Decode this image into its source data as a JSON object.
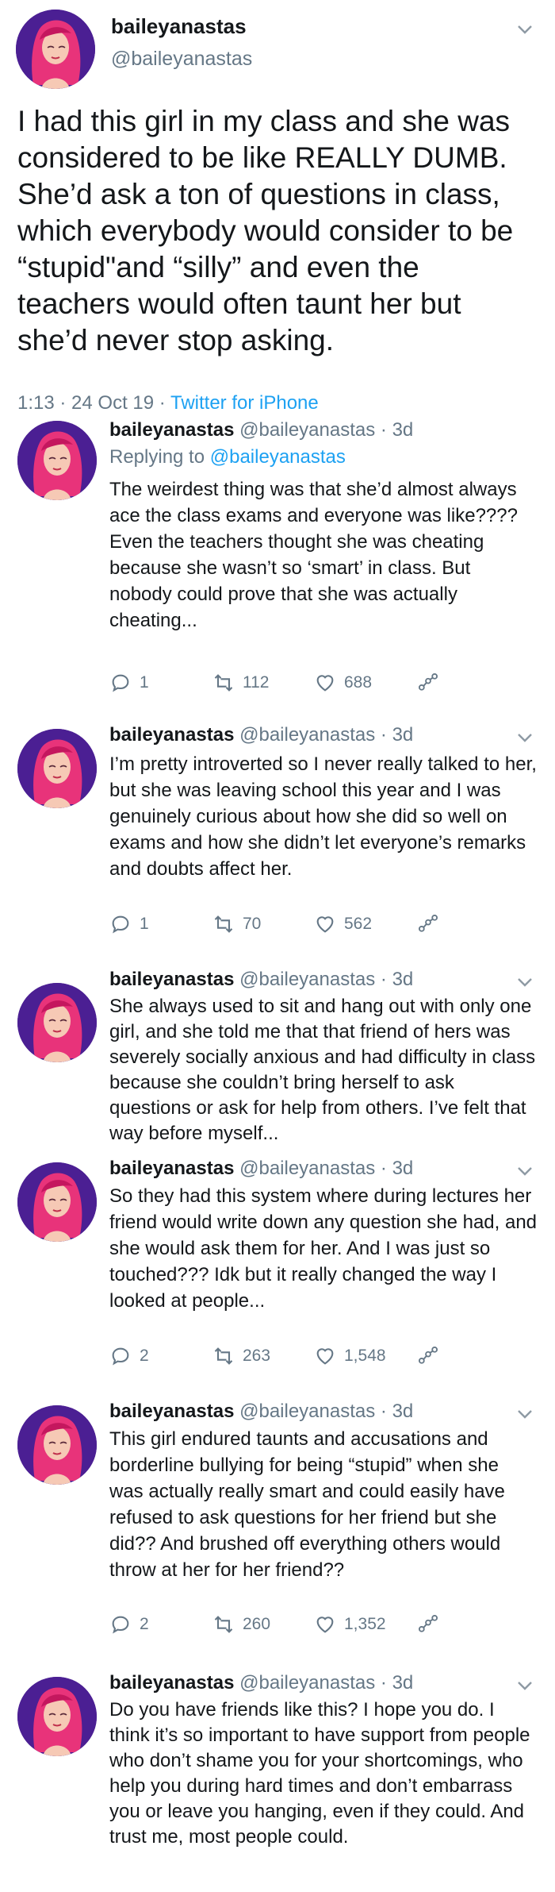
{
  "main_tweet": {
    "display_name": "baileyanastas",
    "handle": "@baileyanastas",
    "text": "I had this girl in my class and she was considered to be like REALLY DUMB. She’d ask a ton of questions in class, which everybody would consider to be “stupid\"and “silly” and even the teachers would often taunt her but she’d never stop asking.",
    "time": "1:13 · 24 Oct 19 · ",
    "source": "Twitter for iPhone"
  },
  "replies": [
    {
      "name": "baileyanastas",
      "handle_age": "@baileyanastas · 3d",
      "replying_prefix": "Replying to ",
      "replying_to": "@baileyanastas",
      "text": "The weirdest thing was that she’d almost always ace the class exams and everyone was like???? Even the teachers thought she was cheating because she wasn’t so ‘smart’ in class. But nobody could prove that she was actually cheating...",
      "replies_count": "1",
      "retweets": "112",
      "likes": "688"
    },
    {
      "name": "baileyanastas",
      "handle_age": "@baileyanastas · 3d",
      "text": "I’m pretty introverted so I never really talked to her, but she was leaving school this year and I was genuinely curious about how she did so well on exams and how she didn’t let everyone’s remarks and doubts affect her.",
      "replies_count": "1",
      "retweets": "70",
      "likes": "562"
    },
    {
      "name": "baileyanastas",
      "handle_age": "@baileyanastas · 3d",
      "text": "She always used to sit and hang out with only one girl, and she told me that that friend of hers was severely socially anxious and had difficulty in class because she couldn’t bring herself to ask questions or ask for help from others. I’ve felt that way before myself..."
    },
    {
      "name": "baileyanastas",
      "handle_age": "@baileyanastas · 3d",
      "text": "So they had this system where during lectures her friend would write down any question she had, and she would ask them for her. And I was just so touched??? Idk but it really changed the way I looked at people...",
      "replies_count": "2",
      "retweets": "263",
      "likes": "1,548"
    },
    {
      "name": "baileyanastas",
      "handle_age": "@baileyanastas · 3d",
      "text": "This girl endured taunts and accusations and borderline bullying for being “stupid” when she was actually really smart and could easily have refused to ask questions for her friend but she did?? And brushed off everything others would throw at her for her friend??",
      "replies_count": "2",
      "retweets": "260",
      "likes": "1,352"
    },
    {
      "name": "baileyanastas",
      "handle_age": "@baileyanastas · 3d",
      "text": "Do you have friends like this? I hope you do. I think it’s so important to have support from people who don’t shame you for your shortcomings, who help you during hard times and don’t embarrass you or leave you hanging, even if they could. And trust me, most people could."
    }
  ],
  "colors": {
    "text": "#14171a",
    "muted": "#657786",
    "link": "#1da1f2",
    "avatar_bg": "#4b1f93",
    "avatar_hair": "#e8337a"
  },
  "icons": {
    "reply": "reply-icon",
    "retweet": "retweet-icon",
    "like": "heart-icon",
    "share": "share-icon",
    "more": "chevron-down-icon"
  }
}
